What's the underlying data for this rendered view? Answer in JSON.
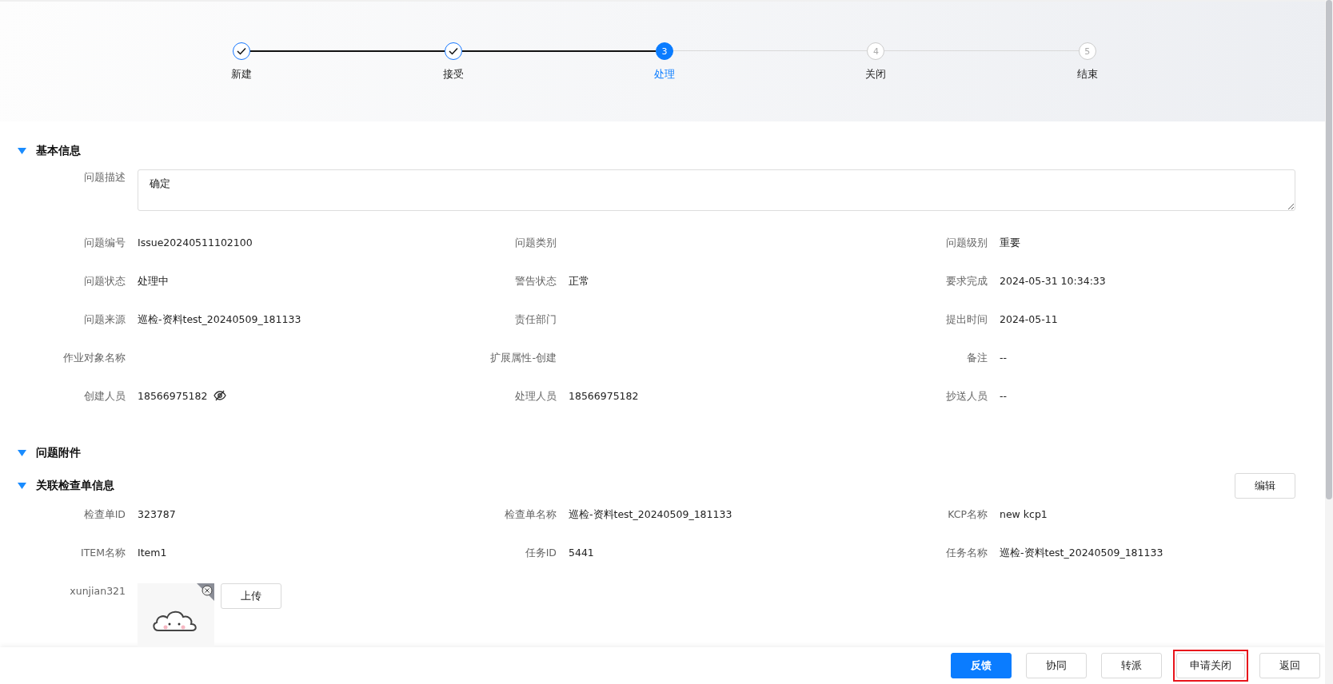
{
  "steps": [
    {
      "label": "新建",
      "completed": true,
      "selected": false
    },
    {
      "label": "接受",
      "completed": true,
      "selected": false
    },
    {
      "label": "处理",
      "number": "3",
      "completed": false,
      "selected": true
    },
    {
      "label": "关闭",
      "number": "4",
      "completed": false,
      "selected": false
    },
    {
      "label": "结束",
      "number": "5",
      "completed": false,
      "selected": false
    }
  ],
  "basic_info": {
    "title": "基本信息",
    "expanded": true,
    "description": {
      "label": "问题描述",
      "value": "确定"
    },
    "fields": [
      {
        "label": "问题编号",
        "value": "Issue20240511102100",
        "kind": "text"
      },
      {
        "label": "问题类别",
        "kind": "text"
      },
      {
        "label": "问题级别",
        "value": "重要",
        "kind": "text"
      },
      {
        "label": "问题状态",
        "value": "处理中",
        "kind": "text"
      },
      {
        "label": "警告状态",
        "value": "正常",
        "kind": "text"
      },
      {
        "label": "要求完成",
        "value": "2024-05-31 10:34:33",
        "kind": "text"
      },
      {
        "label": "问题来源",
        "value": "巡检-资料test_20240509_181133",
        "kind": "text"
      },
      {
        "label": "责任部门",
        "kind": "text"
      },
      {
        "label": "提出时间",
        "value": "2024-05-11",
        "kind": "text"
      },
      {
        "label": "作业对象名称",
        "kind": "text"
      },
      {
        "label": "扩展属性-创建",
        "kind": "text"
      },
      {
        "label": "备注",
        "value": "--",
        "kind": "text"
      },
      {
        "label": "创建人员",
        "value": "18566975182",
        "kind": "masked"
      },
      {
        "label": "处理人员",
        "value": "18566975182",
        "kind": "text"
      },
      {
        "label": "抄送人员",
        "value": "--",
        "kind": "text"
      }
    ]
  },
  "attachments": {
    "title": "问题附件",
    "expanded": true
  },
  "checklist": {
    "title": "关联检查单信息",
    "expanded": true,
    "edit_button": "编辑",
    "fields": [
      {
        "label": "检查单ID",
        "value": "323787",
        "kind": "text"
      },
      {
        "label": "检查单名称",
        "value": "巡检-资料test_20240509_181133",
        "kind": "text"
      },
      {
        "label": "KCP名称",
        "value": "new kcp1",
        "kind": "text"
      },
      {
        "label": "ITEM名称",
        "value": "Item1",
        "kind": "text"
      },
      {
        "label": "任务ID",
        "value": "5441",
        "kind": "text"
      },
      {
        "label": "任务名称",
        "value": "巡检-资料test_20240509_181133",
        "kind": "text"
      }
    ],
    "upload": {
      "label": "xunjian321",
      "button": "上传"
    }
  },
  "footer_buttons": [
    {
      "label": "反馈",
      "kind": "primary",
      "highlighted": false
    },
    {
      "label": "协同",
      "kind": "default",
      "highlighted": false
    },
    {
      "label": "转派",
      "kind": "default",
      "highlighted": false
    },
    {
      "label": "申请关闭",
      "kind": "default",
      "highlighted": true
    },
    {
      "label": "返回",
      "kind": "default",
      "highlighted": false
    }
  ]
}
